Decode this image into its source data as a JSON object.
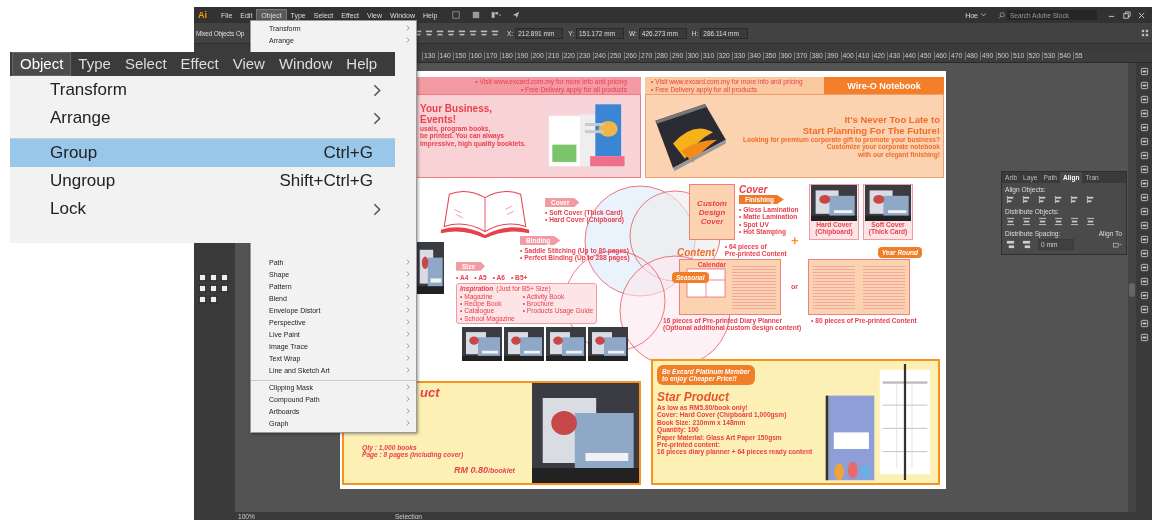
{
  "menu_bar": {
    "logo": "Ai",
    "menus": [
      {
        "label": "File",
        "selected": false
      },
      {
        "label": "Edit",
        "selected": false
      },
      {
        "label": "Object",
        "selected": true
      },
      {
        "label": "Type",
        "selected": false
      },
      {
        "label": "Select",
        "selected": false
      },
      {
        "label": "Effect",
        "selected": false
      },
      {
        "label": "View",
        "selected": false
      },
      {
        "label": "Window",
        "selected": false
      },
      {
        "label": "Help",
        "selected": false
      }
    ],
    "workspace": "Hoe",
    "search": {
      "placeholder": "Search Adobe Stock"
    }
  },
  "control_bar": {
    "selection": "Mixed Objects",
    "opacity": "Op",
    "fields": [
      {
        "label": "X:",
        "value": "212.891 mm"
      },
      {
        "label": "Y:",
        "value": "151.172 mm"
      },
      {
        "label": "W:",
        "value": "426.273 mm"
      },
      {
        "label": "H:",
        "value": "286.114 mm"
      }
    ]
  },
  "ruler": {
    "labels": [
      "130",
      "140",
      "150",
      "160",
      "170",
      "180",
      "190",
      "200",
      "210",
      "220",
      "230",
      "240",
      "250",
      "260",
      "270",
      "280",
      "290",
      "300",
      "310",
      "320",
      "330",
      "340",
      "350",
      "360",
      "370",
      "380",
      "390",
      "400",
      "410",
      "420",
      "430",
      "440",
      "450",
      "460",
      "470",
      "480",
      "490",
      "500",
      "510",
      "520",
      "530",
      "540",
      "55"
    ]
  },
  "object_menu": {
    "top_items": [
      {
        "label": "Transform"
      },
      {
        "label": "Arrange"
      }
    ],
    "lower_items": [
      {
        "label": "Path",
        "separator_before": false
      },
      {
        "label": "Shape",
        "separator_before": false
      },
      {
        "label": "Pattern",
        "separator_before": false
      },
      {
        "label": "Blend",
        "separator_before": false
      },
      {
        "label": "Envelope Distort",
        "separator_before": false
      },
      {
        "label": "Perspective",
        "separator_before": false
      },
      {
        "label": "Live Paint",
        "separator_before": false
      },
      {
        "label": "Image Trace",
        "separator_before": false
      },
      {
        "label": "Text Wrap",
        "separator_before": false
      },
      {
        "label": "Line and Sketch Art",
        "separator_before": false
      },
      {
        "label": "Clipping Mask",
        "separator_before": true
      },
      {
        "label": "Compound Path",
        "separator_before": false
      },
      {
        "label": "Artboards",
        "separator_before": false
      },
      {
        "label": "Graph",
        "separator_before": false
      }
    ]
  },
  "zoom_inset": {
    "menus": [
      {
        "label": "Object",
        "selected": true
      },
      {
        "label": "Type",
        "selected": false
      },
      {
        "label": "Select",
        "selected": false
      },
      {
        "label": "Effect",
        "selected": false
      },
      {
        "label": "View",
        "selected": false
      },
      {
        "label": "Window",
        "selected": false
      },
      {
        "label": "Help",
        "selected": false
      }
    ],
    "items": [
      {
        "label": "Transform",
        "kind": "submenu",
        "separator_before": false,
        "selected": false
      },
      {
        "label": "Arrange",
        "kind": "submenu",
        "separator_before": false,
        "selected": false
      },
      {
        "label": "Group",
        "kind": "command",
        "shortcut": "Ctrl+G",
        "separator_before": true,
        "selected": true
      },
      {
        "label": "Ungroup",
        "kind": "command",
        "shortcut": "Shift+Ctrl+G",
        "separator_before": false,
        "selected": false
      },
      {
        "label": "Lock",
        "kind": "submenu",
        "separator_before": false,
        "selected": false
      }
    ]
  },
  "left_page": {
    "top_note": [
      "• Visit www.excard.com.my for more info and pricing",
      "• Free Delivery apply for all products"
    ],
    "headline": [
      "Your Business,",
      "Events!"
    ],
    "intro": [
      "usals, program books,",
      "be printed. You can always",
      "impressive, high quality booklets."
    ],
    "cover": {
      "label": "Cover",
      "items": [
        "• Soft Cover (Thick Card)",
        "• Hard Cover (Chipboard)"
      ]
    },
    "binding": {
      "label": "Binding",
      "items": [
        "• Saddle Stitching (Up to 80 pages)",
        "• Perfect Binding (Up to 288 pages)"
      ]
    },
    "size": {
      "label": "Size",
      "items": [
        "• A4",
        "• A5",
        "• A6",
        "• B5+"
      ]
    },
    "inspiration": {
      "title": "Inspiration",
      "note": "(Just for B5+ Size)",
      "items": [
        "• Magazine",
        "• Recipe Book",
        "• Catalogue",
        "• School Magazine",
        "• Activity Book",
        "• Brochure",
        "• Products Usage Guide"
      ]
    },
    "product": {
      "title": "uct",
      "specs": [
        "Qty : 1,000 books",
        "Page : 8 pages (including cover)"
      ],
      "price": "RM 0.80",
      "price_unit": "/booklet"
    }
  },
  "right_page": {
    "top_note": [
      "• Visit www.excard.com.my for more info and pricing",
      "• Free Delivery apply for all products"
    ],
    "title": "Wire-O Notebook",
    "headline": [
      "It's Never Too Late to",
      "Start Planning For The Future!"
    ],
    "intro": [
      "Looking for premium corporate gift to promote your business?",
      "Customize your corporate notebook",
      "with our elegant finishing!"
    ],
    "cover_art": [
      "Custom",
      "Design",
      "Cover"
    ],
    "cover_heading": "Cover",
    "finishing_label": "Finishing",
    "finishing": [
      "• Gloss Lamination",
      "• Matte Lamination",
      "• Spot UV",
      "• Hot Stamping"
    ],
    "cover_types": [
      "Hard Cover (Chipboard)",
      "Soft Cover (Thick Card)"
    ],
    "plus": "+",
    "content_heading": "Content",
    "content_note": [
      "• 64 pieces of",
      "Pre-printed Content"
    ],
    "calendar_label": "Calendar",
    "seasonal": "Seasonal",
    "or": "or",
    "year_round": "Year Round",
    "left_caption": [
      "16 pieces of Pre-printed Diary Planner",
      "(Optional additional custom design content)"
    ],
    "right_caption": "• 80 pieces of Pre-printed Content",
    "promo": [
      "Be Excard Platinum Member",
      "to enjoy Cheaper Price!!"
    ],
    "star_title": "Star Product",
    "price_line": "As low as **RM5.80/book** only!",
    "specs": [
      "Cover: Hard Cover (Chipboard 1,000gsm)",
      "Book Size: 210mm x 148mm",
      "Quantity: 100",
      "Paper Material: Glass Art Paper 150gsm",
      "Pre-printed content:",
      "16 pieces diary planner + 64 pieces ready content"
    ]
  },
  "align_panel": {
    "tabs": [
      {
        "label": "Artb",
        "selected": false
      },
      {
        "label": "Laye",
        "selected": false
      },
      {
        "label": "Path",
        "selected": false
      },
      {
        "label": "Align",
        "selected": true
      },
      {
        "label": "Tran",
        "selected": false
      }
    ],
    "align_objects": "Align Objects:",
    "distribute_objects": "Distribute Objects:",
    "distribute_spacing": "Distribute Spacing:",
    "align_to": "Align To",
    "spacing_value": "0 mm"
  },
  "status_bar": {
    "zoom": "100%",
    "tool": "Selection"
  }
}
